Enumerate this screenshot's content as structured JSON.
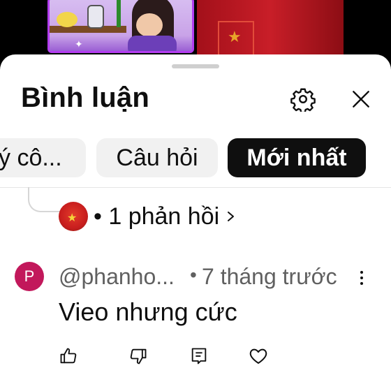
{
  "header": {
    "title": "Bình luận",
    "settings_icon": "gear-icon",
    "close_icon": "close-icon"
  },
  "filters": [
    {
      "label": "ý cô...",
      "selected": false
    },
    {
      "label": "Câu hỏi",
      "selected": false
    },
    {
      "label": "Mới nhất",
      "selected": true
    }
  ],
  "reply_thread": {
    "text": "• 1 phản hồi",
    "chevron": "›"
  },
  "comment": {
    "avatar_letter": "P",
    "avatar_color": "#c2185b",
    "author": "@phanho...",
    "separator": "•",
    "time": "7 tháng trước",
    "body": "Vieo nhưng cức",
    "actions": [
      "thumb-up-icon",
      "thumb-down-icon",
      "reply-icon",
      "heart-icon"
    ]
  },
  "colors": {
    "accent_selected_chip": "#0f0f0f",
    "chip_bg": "#f1f1f1",
    "secondary_text": "#606060"
  }
}
